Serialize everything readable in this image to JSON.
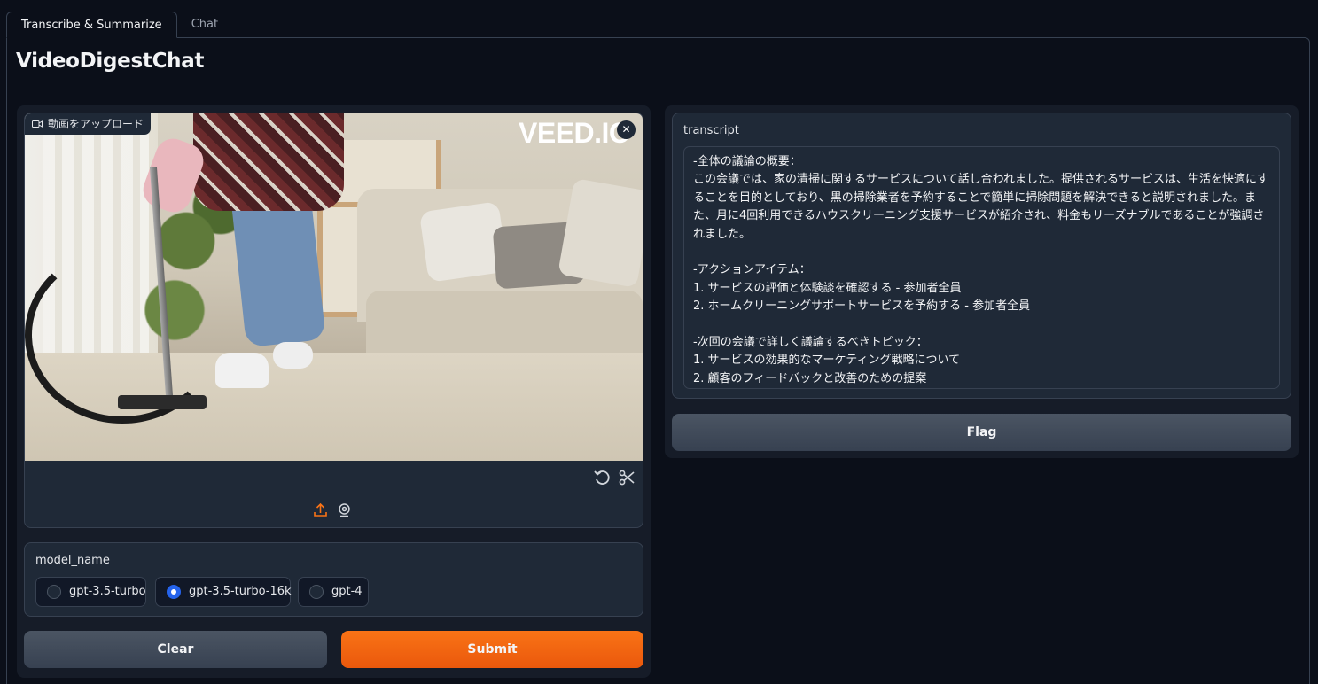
{
  "tabs": [
    {
      "label": "Transcribe & Summarize",
      "active": true
    },
    {
      "label": "Chat",
      "active": false
    }
  ],
  "app_title": "VideoDigestChat",
  "video": {
    "upload_label": "動画をアップロード",
    "watermark": "VEED.IO",
    "close_icon": "close-icon",
    "tool_icons": [
      "undo-icon",
      "scissors-icon"
    ],
    "source_icons": [
      "upload-icon",
      "webcam-icon"
    ]
  },
  "model": {
    "label": "model_name",
    "options": [
      {
        "label": "gpt-3.5-turbo",
        "checked": false
      },
      {
        "label": "gpt-3.5-turbo-16k",
        "checked": true
      },
      {
        "label": "gpt-4",
        "checked": false
      }
    ]
  },
  "buttons": {
    "clear": "Clear",
    "submit": "Submit",
    "flag": "Flag"
  },
  "transcript": {
    "label": "transcript",
    "value": "-全体の議論の概要：\nこの会議では、家の清掃に関するサービスについて話し合われました。提供されるサービスは、生活を快適にすることを目的としており、黒の掃除業者を予約することで簡単に掃除問題を解決できると説明されました。また、月に4回利用できるハウスクリーニング支援サービスが紹介され、料金もリーズナブルであることが強調されました。\n\n-アクションアイテム：\n1. サービスの評価と体験談を確認する - 参加者全員\n2. ホームクリーニングサポートサービスを予約する - 参加者全員\n\n-次回の会議で詳しく議論するべきトピック：\n1. サービスの効果的なマーケティング戦略について\n2. 顧客のフィードバックと改善のための提案"
  },
  "colors": {
    "background": "#0b0f19",
    "block": "#1f2937",
    "accent_orange": "#f97316",
    "radio_selected": "#2563eb"
  }
}
